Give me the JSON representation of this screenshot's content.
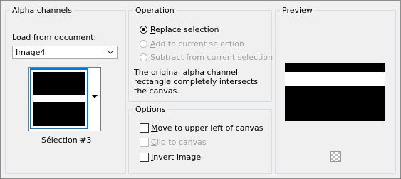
{
  "alpha_channels": {
    "title": "Alpha channels",
    "load_label": "Load from document:",
    "document_value": "Image4",
    "selection_name": "Sélection #3"
  },
  "operation": {
    "title": "Operation",
    "replace_label": "Replace selection",
    "add_label": "Add to current selection",
    "subtract_label": "Subtract from current selection",
    "selected": "replace",
    "description": "The original alpha channel rectangle completely intersects the canvas."
  },
  "options": {
    "title": "Options",
    "move_label": "Move to upper left of canvas",
    "clip_label": "Clip to canvas",
    "invert_label": "Invert image"
  },
  "preview": {
    "title": "Preview",
    "transparency_icon": "checkerboard-icon"
  }
}
